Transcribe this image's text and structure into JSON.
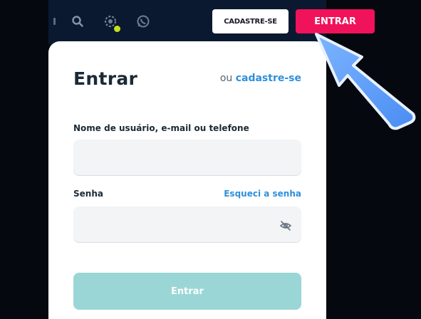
{
  "header": {
    "signup_button": "CADASTRE-SE",
    "login_button": "ENTRAR",
    "icons": [
      "search-icon",
      "gift-icon",
      "whatsapp-icon"
    ],
    "colors": {
      "bar": "#0b1930",
      "login": "#f0125a",
      "badge": "#c6e21a"
    }
  },
  "login_panel": {
    "title": "Entrar",
    "alt_prefix": "ou",
    "alt_link": "cadastre-se",
    "username_label": "Nome de usuário, e-mail ou telefone",
    "username_value": "",
    "password_label": "Senha",
    "password_value": "",
    "forgot_link": "Esqueci a senha",
    "submit_label": "Entrar",
    "colors": {
      "link": "#2f8fdb",
      "submit": "#9ad6d6"
    }
  }
}
